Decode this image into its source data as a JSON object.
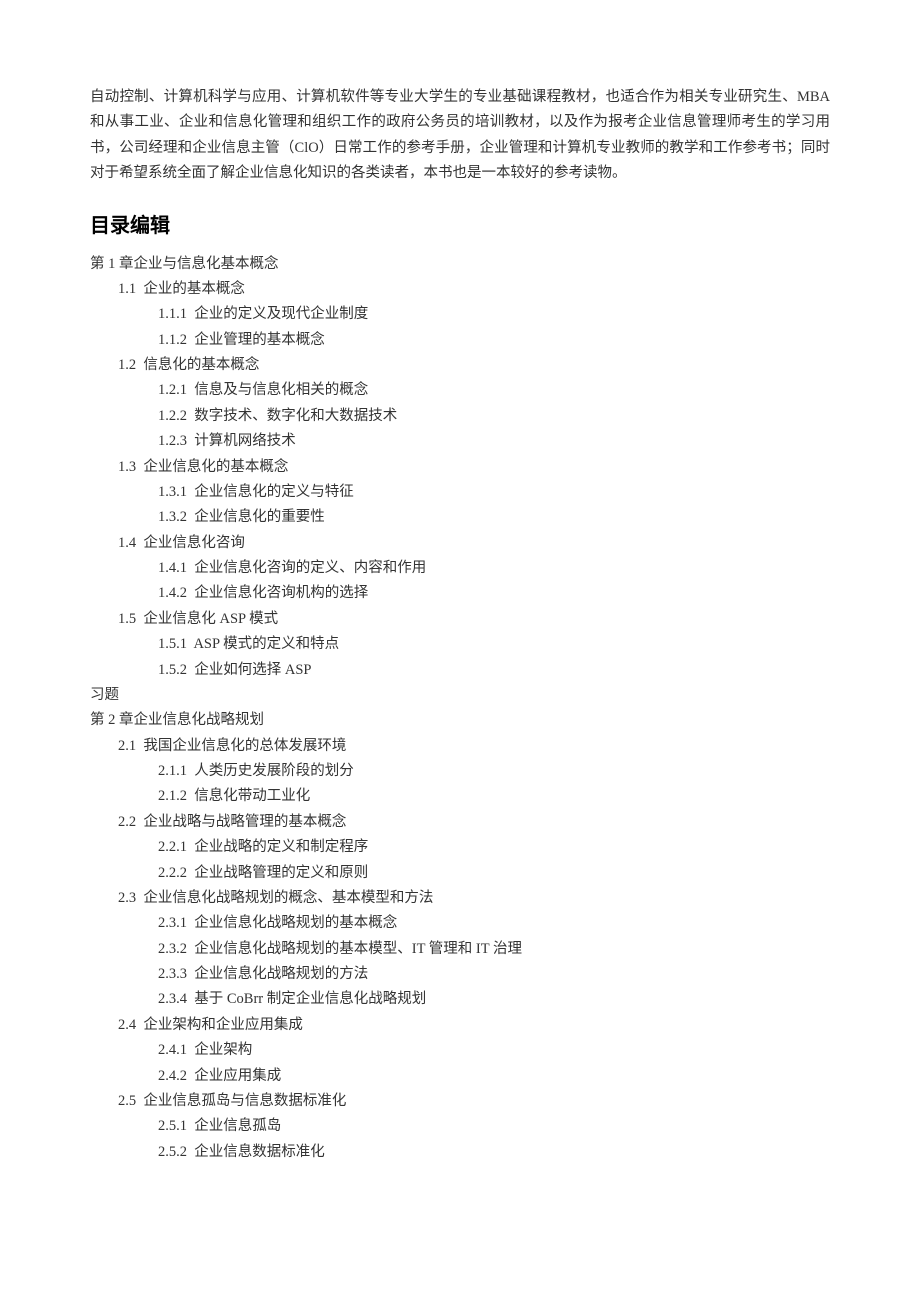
{
  "intro_paragraph": "自动控制、计算机科学与应用、计算机软件等专业大学生的专业基础课程教材，也适合作为相关专业研究生、MBA 和从事工业、企业和信息化管理和组织工作的政府公务员的培训教材，以及作为报考企业信息管理师考生的学习用书，公司经理和企业信息主管（ClO）日常工作的参考手册，企业管理和计算机专业教师的教学和工作参考书；同时对于希望系统全面了解企业信息化知识的各类读者，本书也是一本较好的参考读物。",
  "toc_heading": "目录编辑",
  "toc": [
    {
      "level": 0,
      "text": "第 1 章企业与信息化基本概念"
    },
    {
      "level": 1,
      "text": "1.1  企业的基本概念"
    },
    {
      "level": 2,
      "text": "1.1.1  企业的定义及现代企业制度"
    },
    {
      "level": 2,
      "text": "1.1.2  企业管理的基本概念"
    },
    {
      "level": 1,
      "text": "1.2  信息化的基本概念"
    },
    {
      "level": 2,
      "text": "1.2.1  信息及与信息化相关的概念"
    },
    {
      "level": 2,
      "text": "1.2.2  数字技术、数字化和大数据技术"
    },
    {
      "level": 2,
      "text": "1.2.3  计算机网络技术"
    },
    {
      "level": 1,
      "text": "1.3  企业信息化的基本概念"
    },
    {
      "level": 2,
      "text": "1.3.1  企业信息化的定义与特征"
    },
    {
      "level": 2,
      "text": "1.3.2  企业信息化的重要性"
    },
    {
      "level": 1,
      "text": "1.4  企业信息化咨询"
    },
    {
      "level": 2,
      "text": "1.4.1  企业信息化咨询的定义、内容和作用"
    },
    {
      "level": 2,
      "text": "1.4.2  企业信息化咨询机构的选择"
    },
    {
      "level": 1,
      "text": "1.5  企业信息化 ASP 模式"
    },
    {
      "level": 2,
      "text": "1.5.1  ASP 模式的定义和特点"
    },
    {
      "level": 2,
      "text": "1.5.2  企业如何选择 ASP"
    },
    {
      "level": "exercise",
      "text": "习题"
    },
    {
      "level": 0,
      "text": "第 2 章企业信息化战略规划"
    },
    {
      "level": 1,
      "text": "2.1  我国企业信息化的总体发展环境"
    },
    {
      "level": 2,
      "text": "2.1.1  人类历史发展阶段的划分"
    },
    {
      "level": 2,
      "text": "2.1.2  信息化带动工业化"
    },
    {
      "level": 1,
      "text": "2.2  企业战略与战略管理的基本概念"
    },
    {
      "level": 2,
      "text": "2.2.1  企业战略的定义和制定程序"
    },
    {
      "level": 2,
      "text": "2.2.2  企业战略管理的定义和原则"
    },
    {
      "level": 1,
      "text": "2.3  企业信息化战略规划的概念、基本模型和方法"
    },
    {
      "level": 2,
      "text": "2.3.1  企业信息化战略规划的基本概念"
    },
    {
      "level": 2,
      "text": "2.3.2  企业信息化战略规划的基本模型、IT 管理和 IT 治理"
    },
    {
      "level": 2,
      "text": "2.3.3  企业信息化战略规划的方法"
    },
    {
      "level": 2,
      "text": "2.3.4  基于 CoBrr 制定企业信息化战略规划"
    },
    {
      "level": 1,
      "text": "2.4  企业架构和企业应用集成"
    },
    {
      "level": 2,
      "text": "2.4.1  企业架构"
    },
    {
      "level": 2,
      "text": "2.4.2  企业应用集成"
    },
    {
      "level": 1,
      "text": "2.5  企业信息孤岛与信息数据标准化"
    },
    {
      "level": 2,
      "text": "2.5.1  企业信息孤岛"
    },
    {
      "level": 2,
      "text": "2.5.2  企业信息数据标准化"
    }
  ]
}
